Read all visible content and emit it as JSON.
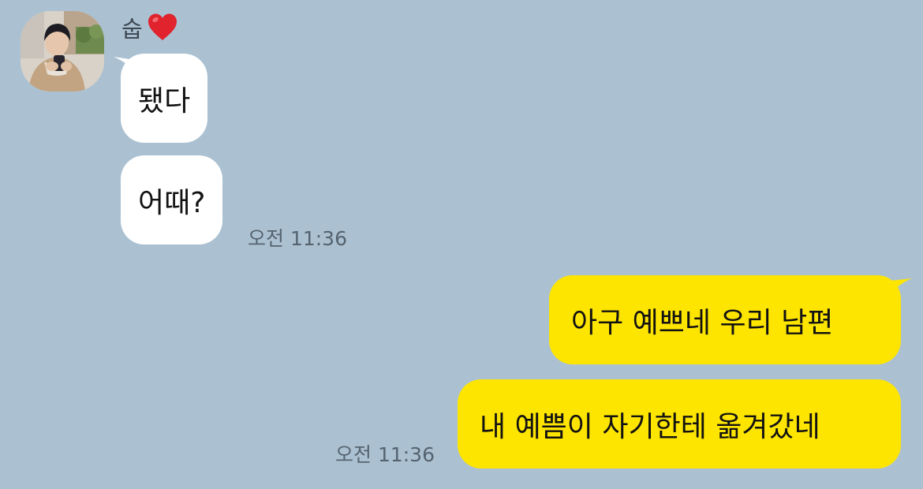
{
  "conversation": {
    "sender": {
      "name": "숩",
      "badge_icon": "red-heart-icon",
      "badge_color": "#e1232e",
      "avatar_icon": "profile-photo"
    },
    "messages": [
      {
        "direction": "incoming",
        "text": "됐다"
      },
      {
        "direction": "incoming",
        "text": "어때?",
        "time": "오전 11:36"
      },
      {
        "direction": "outgoing",
        "text": "아구 예쁘네 우리 남편"
      },
      {
        "direction": "outgoing",
        "text": "내 예쁨이 자기한테 옮겨갔네",
        "time": "오전 11:36"
      }
    ]
  },
  "colors": {
    "background": "#abc1d1",
    "incoming_bubble": "#ffffff",
    "outgoing_bubble": "#fee500",
    "timestamp": "#56636f",
    "sender_name": "#3c4650"
  }
}
